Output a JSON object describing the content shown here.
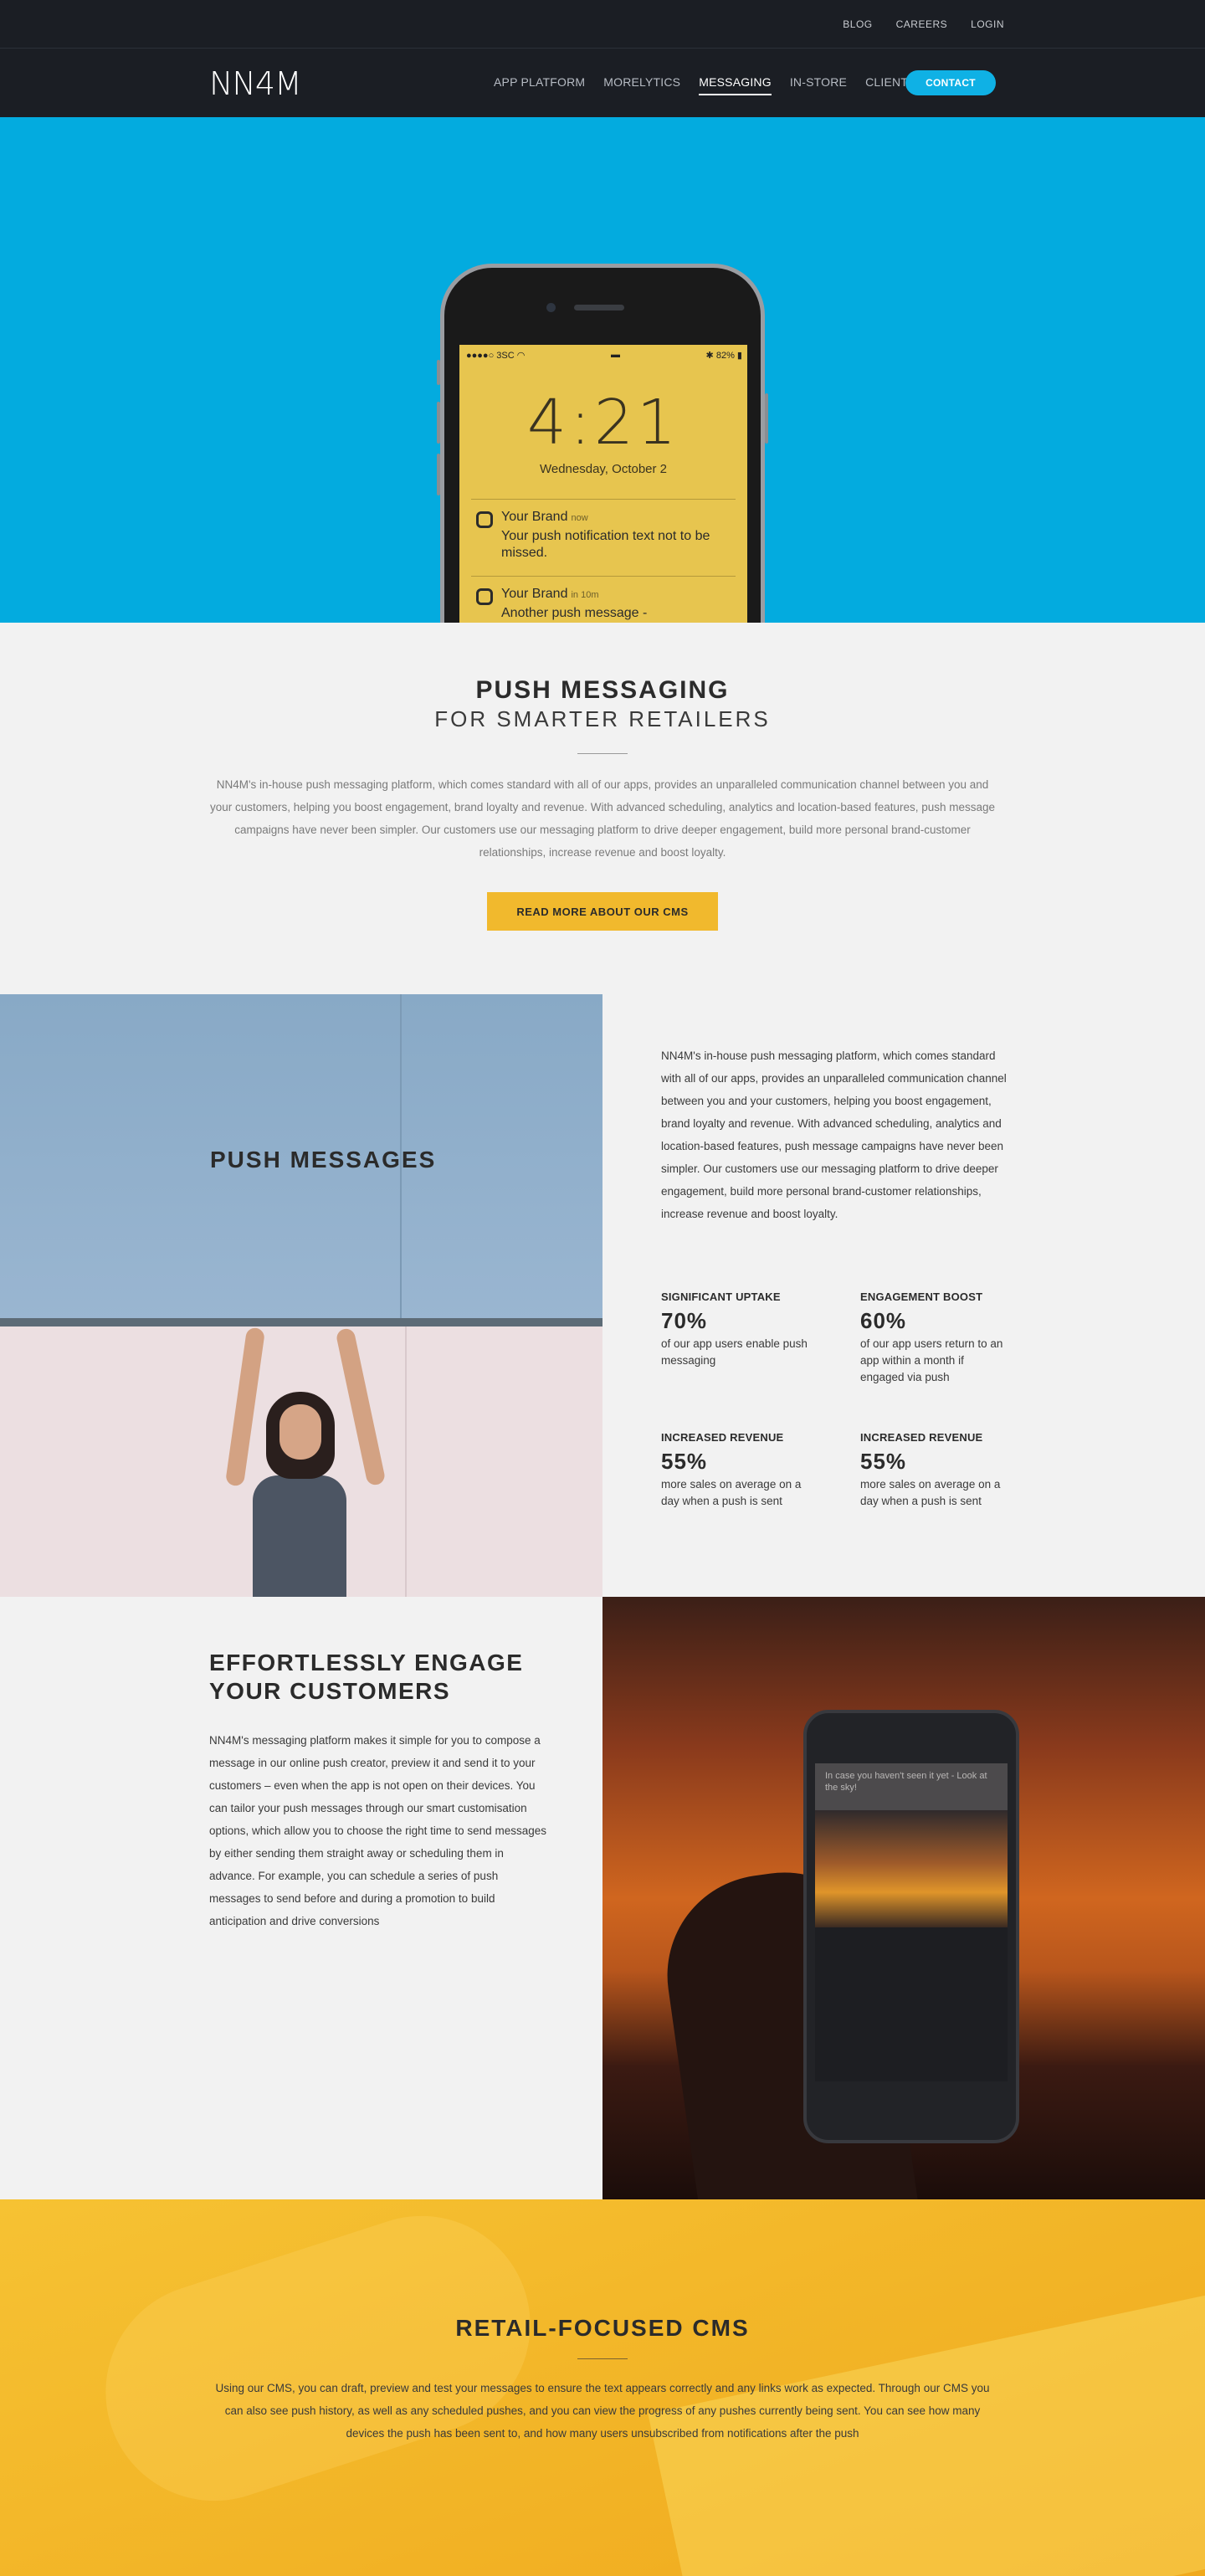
{
  "topbar": {
    "links": [
      "BLOG",
      "CAREERS",
      "LOGIN"
    ]
  },
  "nav": {
    "logo": "NN4M",
    "items": [
      "APP PLATFORM",
      "MORELYTICS",
      "MESSAGING",
      "IN-STORE",
      "CLIENTS"
    ],
    "active": "MESSAGING",
    "contact": "CONTACT"
  },
  "hero": {
    "status_left": "●●●●○ 3SC",
    "status_right": "82%",
    "time": "4:21",
    "date": "Wednesday, October 2",
    "notifications": [
      {
        "brand": "Your Brand",
        "when": "now",
        "text": "Your push notification text not to be missed."
      },
      {
        "brand": "Your Brand",
        "when": "in 10m",
        "text": "Another push message -"
      }
    ]
  },
  "intro": {
    "title": "PUSH MESSAGING",
    "subtitle": "FOR SMARTER RETAILERS",
    "body": "NN4M's in-house push messaging platform, which comes standard with all of our apps, provides an unparalleled communication channel between you and your customers, helping you boost engagement, brand loyalty and revenue. With advanced scheduling, analytics and location-based features, push message campaigns have never been simpler. Our customers use our messaging platform to drive deeper engagement, build more personal brand-customer relationships, increase revenue and boost loyalty.",
    "button": "READ MORE ABOUT OUR CMS"
  },
  "push": {
    "title": "PUSH MESSAGES",
    "body": "NN4M's in-house push messaging platform, which comes standard with all of our apps, provides an unparalleled communication channel between you and your customers, helping you boost engagement, brand loyalty and revenue. With advanced scheduling, analytics and location-based features, push message campaigns have never been simpler. Our customers use our messaging platform to drive deeper engagement, build more personal brand-customer relationships, increase revenue and boost loyalty.",
    "stats": [
      {
        "label": "SIGNIFICANT UPTAKE",
        "value": "70%",
        "desc": "of our app users enable push messaging"
      },
      {
        "label": "ENGAGEMENT BOOST",
        "value": "60%",
        "desc": "of our app users return to an app within a month if engaged via push"
      },
      {
        "label": "INCREASED REVENUE",
        "value": "55%",
        "desc": "more sales on average on a day when a push is sent"
      },
      {
        "label": "INCREASED REVENUE",
        "value": "55%",
        "desc": "more sales on average on a day when a push is sent"
      }
    ]
  },
  "engage": {
    "title": "EFFORTLESSLY ENGAGE YOUR CUSTOMERS",
    "body": "NN4M's messaging platform makes it simple for you to compose a message in our online push creator, preview it and send it to your customers – even when the app is not open on their devices. You can tailor your push messages through our smart customisation options, which allow you to choose the right time to send messages by either sending them straight away or scheduling them in advance. For example, you can schedule a series of push messages to send before and during a promotion to build anticipation and drive conversions",
    "phone_message": "In case you haven't seen it yet - Look at the sky!"
  },
  "retail": {
    "title": "RETAIL-FOCUSED CMS",
    "body": "Using our CMS, you can draft, preview and test your messages to ensure the text appears correctly and any links work as expected. Through our CMS you can also see push history, as well as any scheduled pushes, and you can view the progress of any pushes currently being sent. You can see how many devices the push has been sent to, and how many users unsubscribed from notifications after the push"
  }
}
